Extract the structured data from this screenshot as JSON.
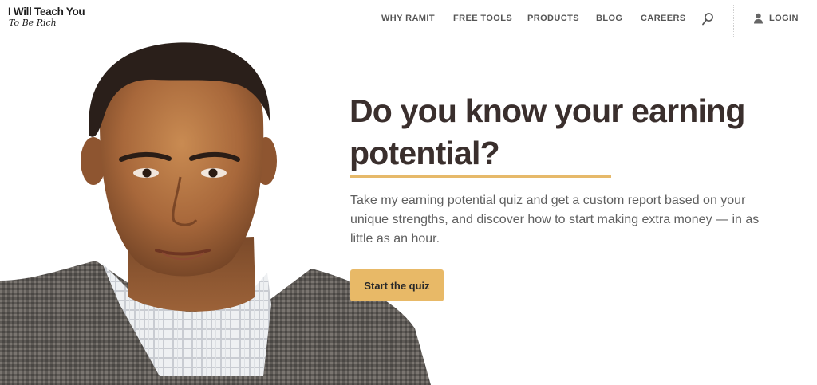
{
  "brand": {
    "name_line1": "I Will Teach You",
    "name_line2": "To Be Rich"
  },
  "nav": {
    "items": [
      {
        "label": "WHY RAMIT"
      },
      {
        "label": "FREE TOOLS"
      },
      {
        "label": "PRODUCTS"
      },
      {
        "label": "BLOG"
      },
      {
        "label": "CAREERS"
      }
    ],
    "search_icon": "search-icon",
    "login_icon": "user-icon",
    "login_label": "LOGIN"
  },
  "hero": {
    "headline": "Do you know your earning potential?",
    "description": "Take my earning potential quiz and get a custom report based on your unique strengths, and discover how to start making extra money — in as little as an hour.",
    "cta_label": "Start the quiz",
    "image": "portrait of man in checked shirt and tweed blazer"
  },
  "colors": {
    "accent": "#e8b967",
    "headline": "#3a2f2d",
    "body": "#5f5f5f",
    "nav": "#555555"
  }
}
